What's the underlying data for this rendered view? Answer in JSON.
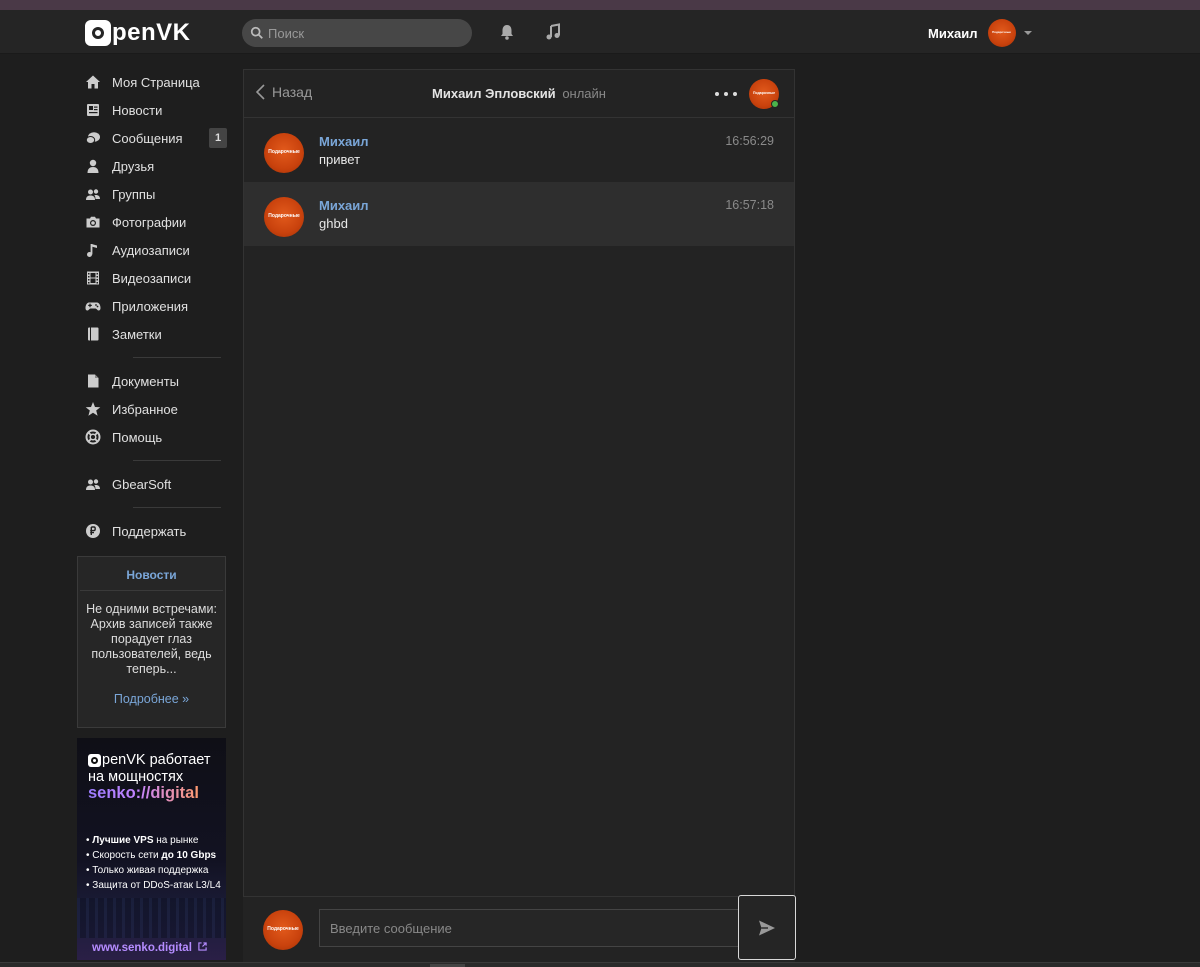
{
  "header": {
    "logo_text": "penVK",
    "search_placeholder": "Поиск",
    "user_name": "Михаил"
  },
  "avatar_text": "Подарочные",
  "sidebar": {
    "items": [
      {
        "label": "Моя Страница",
        "icon": "home-icon"
      },
      {
        "label": "Новости",
        "icon": "newspaper-icon"
      },
      {
        "label": "Сообщения",
        "icon": "chat-icon",
        "badge": "1"
      },
      {
        "label": "Друзья",
        "icon": "person-icon"
      },
      {
        "label": "Группы",
        "icon": "group-icon"
      },
      {
        "label": "Фотографии",
        "icon": "camera-icon"
      },
      {
        "label": "Аудиозаписи",
        "icon": "music-note-icon"
      },
      {
        "label": "Видеозаписи",
        "icon": "film-icon"
      },
      {
        "label": "Приложения",
        "icon": "gamepad-icon"
      },
      {
        "label": "Заметки",
        "icon": "notebook-icon"
      }
    ],
    "items2": [
      {
        "label": "Документы",
        "icon": "document-icon"
      },
      {
        "label": "Избранное",
        "icon": "star-icon"
      },
      {
        "label": "Помощь",
        "icon": "lifebuoy-icon"
      }
    ],
    "group_item": {
      "label": "GbearSoft",
      "icon": "group-icon"
    },
    "support_item": {
      "label": "Поддержать",
      "icon": "ruble-coin-icon"
    }
  },
  "news_box": {
    "title": "Новости",
    "text": "Не одними встречами: Архив записей также порадует глаз пользователей, ведь теперь...",
    "more": "Подробнее »"
  },
  "ad": {
    "line1": "penVK работает",
    "line2": "на мощностях",
    "line3": "senko://digital",
    "bullets": [
      {
        "bold": "Лучшие VPS",
        "rest": " на рынке"
      },
      {
        "pre": "Скорость сети ",
        "bold": "до 10 Gbps"
      },
      {
        "pre": "Только живая поддержка"
      },
      {
        "pre": "Защита от DDoS-атак L3/L4"
      }
    ],
    "url": "www.senko.digital"
  },
  "chat": {
    "back_label": "Назад",
    "peer_name": "Михаил Эпловский",
    "peer_status": "онлайн",
    "messages": [
      {
        "author": "Михаил",
        "text": "привет",
        "time": "16:56:29"
      },
      {
        "author": "Михаил",
        "text": "ghbd",
        "time": "16:57:18"
      }
    ],
    "input_placeholder": "Введите сообщение"
  },
  "colors": {
    "accent_link": "#7aa6d8",
    "online": "#4bb34b",
    "topstrip": "#4a3947"
  }
}
